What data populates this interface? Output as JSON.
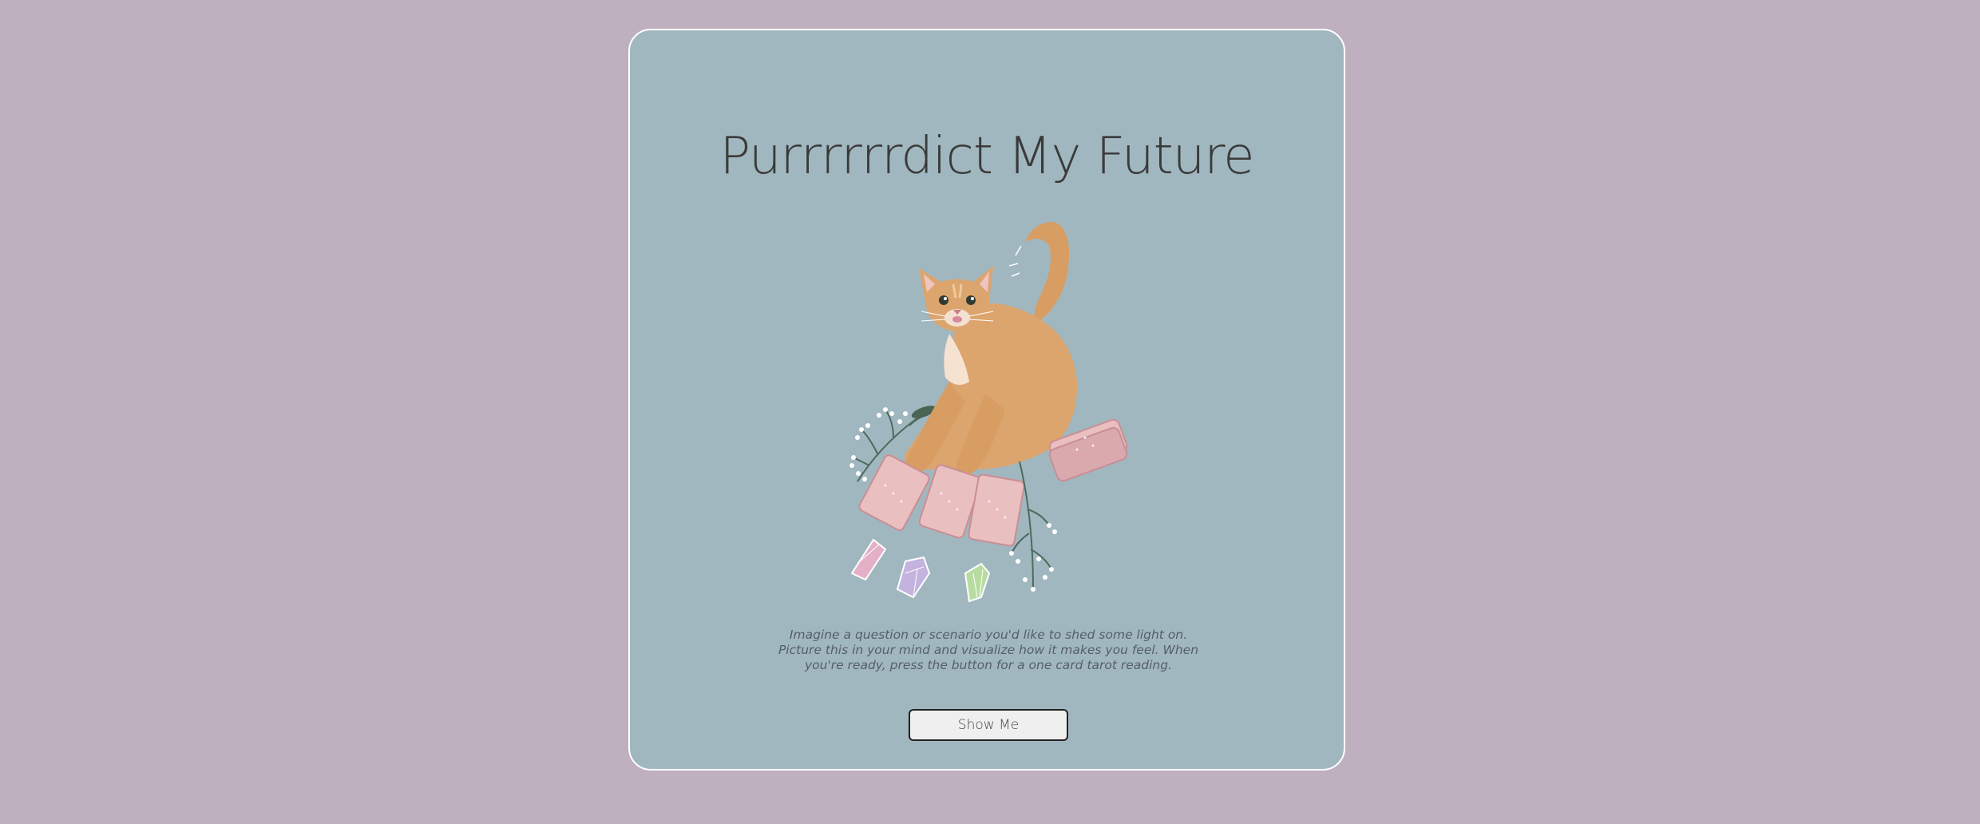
{
  "page": {
    "title": "Purrrrrrdict My Future",
    "description": "Imagine a question or scenario you'd like to shed some light on. Picture this in your mind and visualize how it makes you feel. When you're ready, press the button for a one card tarot reading.",
    "button_label": "Show Me"
  },
  "illustration": {
    "icon": "cat-tarot-illustration",
    "elements": [
      "orange-cat",
      "tarot-cards",
      "crystals",
      "baby-breath-sprigs"
    ]
  },
  "colors": {
    "background": "#bfb0c0",
    "card": "#a1b7bf",
    "card_border": "#ffffff",
    "title_text": "#3a3a3a",
    "cat": "#dca56e",
    "tarot_card": "#e9bfc0"
  }
}
